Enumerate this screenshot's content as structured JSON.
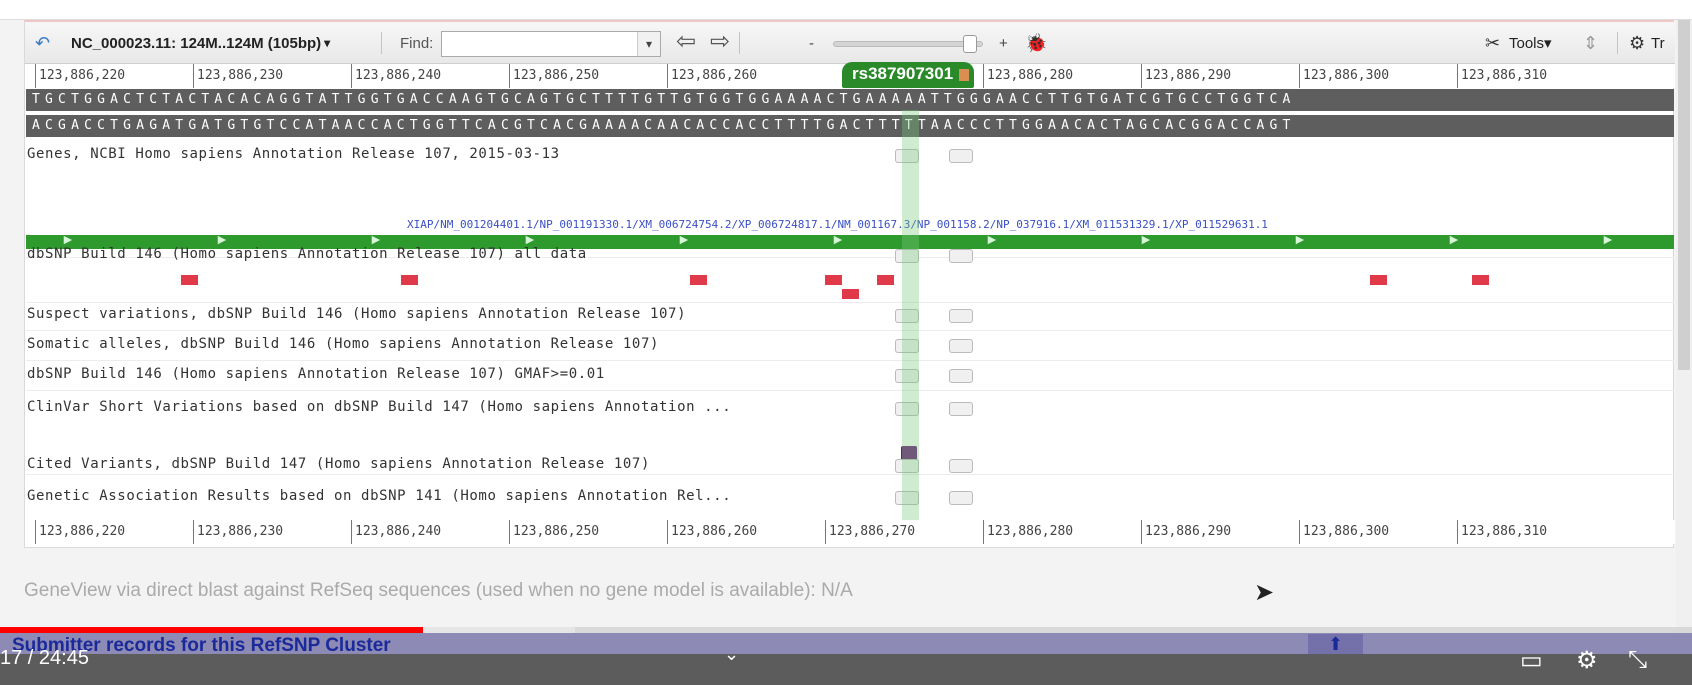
{
  "toolbar": {
    "accession": "NC_000023.11: 124M..124M (105bp)",
    "accession_dropdown": "▾",
    "find_label": "Find:",
    "find_value": "",
    "zoom_out": "-",
    "zoom_in": "+",
    "tools_label": "Tools",
    "tr_label": "Tr"
  },
  "ruler_labels": [
    "123,886,220",
    "123,886,230",
    "123,886,240",
    "123,886,250",
    "123,886,260",
    "123,886,270",
    "123,886,280",
    "123,886,290",
    "123,886,300",
    "123,886,310"
  ],
  "top_ruler_labels": [
    "123,886,220",
    "123,886,230",
    "123,886,240",
    "123,886,250",
    "123,886,260",
    "123,886,280",
    "123,886,290",
    "123,886,300",
    "123,886,310"
  ],
  "snp_marker": "rs387907301",
  "sequence": {
    "forward": "TGCTGGACTCTACTACACAGGTATTGGTGACCAAGTGCAGTGCTTTTGTTGTGGTGGAAAACTGAAAAATTGGGAACCTTGTGATCGTGCCTGGTCA",
    "reverse": "ACGACCTGAGATGATGTGTCCATAACCACTGGTTCACGTCACGAAAACAACACCACCTTTTGACTTTTTAACCCTTGGAACACTAGCACGGACCAGT"
  },
  "tracks": {
    "genes": "Genes, NCBI Homo sapiens Annotation Release 107, 2015-03-13",
    "gene_transcripts": "XIAP/NM_001204401.1/NP_001191330.1/XM_006724754.2/XP_006724817.1/NM_001167.3/NP_001158.2/NP_037916.1/XM_011531329.1/XP_011529631.1",
    "dbsnp_all": "dbSNP Build 146 (Homo sapiens Annotation Release 107) all data",
    "suspect": "Suspect variations, dbSNP Build 146 (Homo sapiens Annotation Release 107)",
    "somatic": "Somatic alleles, dbSNP Build 146 (Homo sapiens Annotation Release 107)",
    "gmaf": "dbSNP Build 146 (Homo sapiens Annotation Release 107) GMAF>=0.01",
    "clinvar": "ClinVar Short Variations based on dbSNP Build 147 (Homo sapiens Annotation ...",
    "cited": "Cited Variants, dbSNP Build 147 (Homo sapiens Annotation Release 107)",
    "gwas": "Genetic Association Results based on dbSNP 141 (Homo sapiens Annotation Rel..."
  },
  "gene_view_text": "GeneView via direct blast against RefSeq sequences (used when no gene model is available): N/A",
  "submitter_text": "Submitter records for this RefSNP Cluster",
  "video": {
    "time": "17 / 24:45",
    "progress_fraction": 0.25,
    "buffered_fraction": 0.34
  },
  "colors": {
    "gene_bar": "#2e9a2e",
    "snp_marker": "#2a8a2a",
    "variant": "#e03a4a",
    "clinvar": "#6b1f7a",
    "progress": "#ff0000"
  }
}
